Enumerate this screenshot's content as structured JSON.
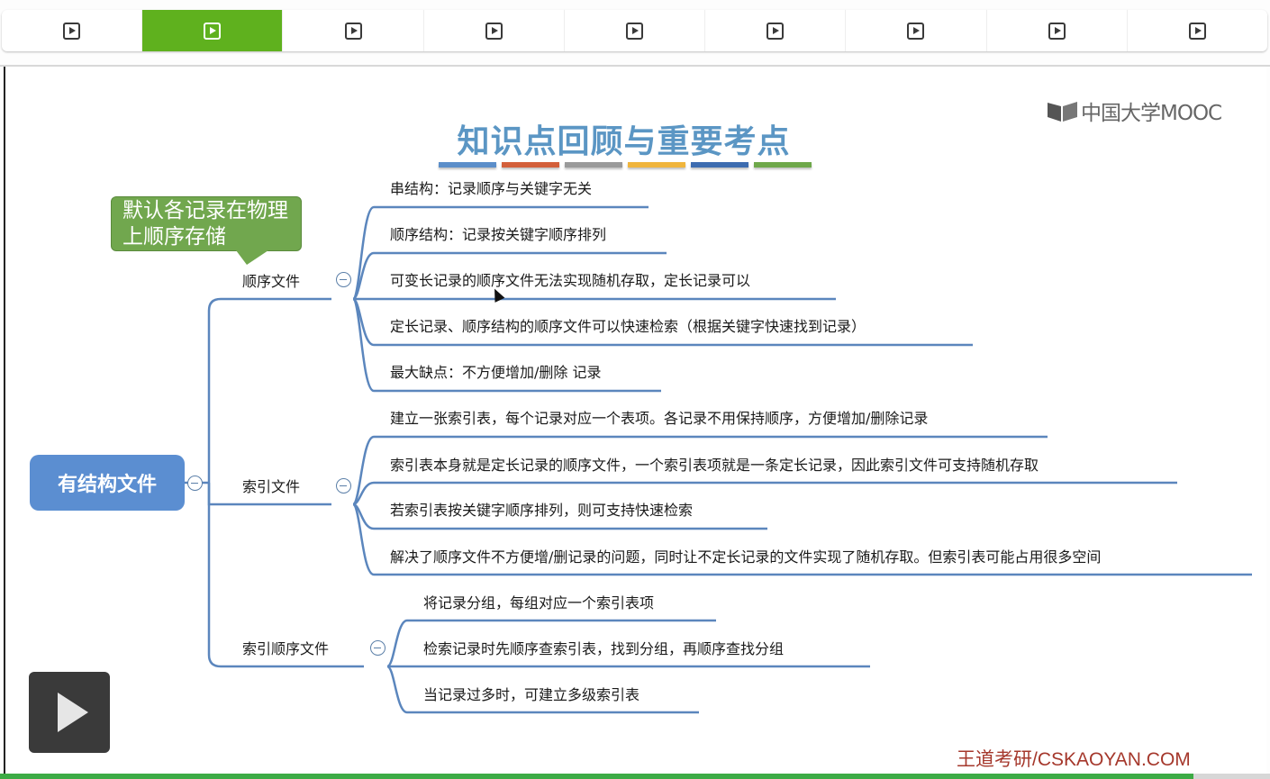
{
  "chapter_bar": {
    "active_index": 1,
    "items": [
      "play-icon",
      "play-icon",
      "play-icon",
      "play-icon",
      "play-icon",
      "play-icon",
      "play-icon",
      "play-icon",
      "play-icon"
    ]
  },
  "slide": {
    "logo_text": "中国大学MOOC",
    "title": "知识点回顾与重要考点",
    "title_bar_colors": [
      "#5b8ec9",
      "#d35f3a",
      "#9a9a9a",
      "#f0b53c",
      "#3d6cb0",
      "#6ea84a"
    ],
    "callout": "默认各记录在物理上顺序存储",
    "root": "有结构文件",
    "branches": [
      {
        "label": "顺序文件",
        "items": [
          "串结构：记录顺序与关键字无关",
          "顺序结构：记录按关键字顺序排列",
          "可变长记录的顺序文件无法实现随机存取，定长记录可以",
          "定长记录、顺序结构的顺序文件可以快速检索（根据关键字快速找到记录）",
          "最大缺点：不方便增加/删除 记录"
        ]
      },
      {
        "label": "索引文件",
        "items": [
          "建立一张索引表，每个记录对应一个表项。各记录不用保持顺序，方便增加/删除记录",
          "索引表本身就是定长记录的顺序文件，一个索引表项就是一条定长记录，因此索引文件可支持随机存取",
          "若索引表按关键字顺序排列，则可支持快速检索",
          "解决了顺序文件不方便增/删记录的问题，同时让不定长记录的文件实现了随机存取。但索引表可能占用很多空间"
        ]
      },
      {
        "label": "索引顺序文件",
        "items": [
          "将记录分组，每组对应一个索引表项",
          "检索记录时先顺序查索引表，找到分组，再顺序查找分组",
          "当记录过多时，可建立多级索引表"
        ]
      }
    ],
    "watermark": "王道考研/CSKAOYAN.COM",
    "link_color": "#5b86bd"
  },
  "player": {
    "play_button": "play-icon"
  }
}
